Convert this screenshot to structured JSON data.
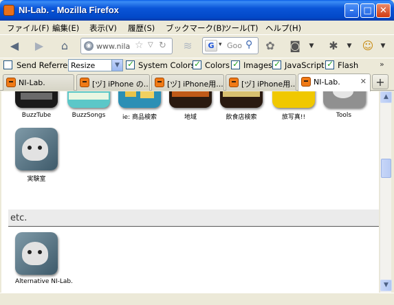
{
  "window": {
    "title": "NI-Lab. - Mozilla Firefox"
  },
  "menu": [
    "ファイル(F)",
    "編集(E)",
    "表示(V)",
    "履歴(S)",
    "ブックマーク(B)",
    "ツール(T)",
    "ヘルプ(H)"
  ],
  "nav": {
    "url": "www.nilab",
    "search_placeholder": "Goo",
    "search_engine": "G"
  },
  "devbar": {
    "send_referrer": "Send Referrer",
    "resize": "Resize",
    "system_colors": "System Colors",
    "colors": "Colors",
    "images": "Images",
    "javascript": "JavaScript",
    "flash": "Flash"
  },
  "tabs": [
    {
      "label": "NI-Lab."
    },
    {
      "label": "[ヅ] iPhone の..."
    },
    {
      "label": "[ヅ] iPhone用..."
    },
    {
      "label": "[ヅ] iPhone用..."
    },
    {
      "label": "NI-Lab."
    }
  ],
  "content": {
    "icons_row1": [
      {
        "label": "BuzzTube",
        "color": "#1a1a1a"
      },
      {
        "label": "BuzzSongs",
        "color": "#5bc7c8"
      },
      {
        "label": "ie: 商品検索",
        "color": "#2b8fb5"
      },
      {
        "label": "地域",
        "color": "#2a1a10"
      },
      {
        "label": "飲食店検索",
        "color": "#2a1a10"
      },
      {
        "label": "旅写真!!",
        "color": "#f0c800"
      },
      {
        "label": "Tools",
        "color": "#707070"
      }
    ],
    "icons_row2": [
      {
        "label": "実験室"
      }
    ],
    "section_etc": "etc.",
    "icons_etc": [
      {
        "label": "Alternative NI-Lab."
      }
    ]
  }
}
